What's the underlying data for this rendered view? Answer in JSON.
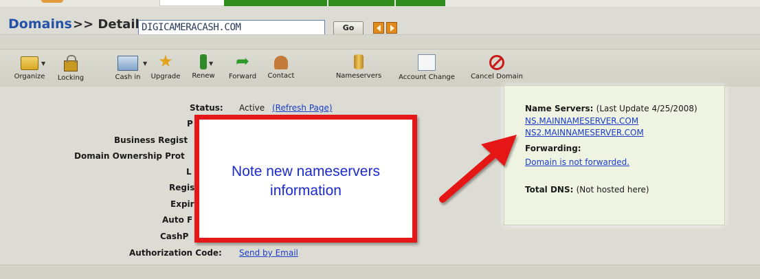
{
  "header": {
    "domains_label": "Domains",
    "details_label": ">> Details:",
    "domain_value": "DIGICAMERACASH.COM",
    "go_label": "Go"
  },
  "toolbar": {
    "items": [
      {
        "label": "Organize",
        "icon": "folder-icon"
      },
      {
        "label": "Locking",
        "icon": "lock-icon"
      },
      {
        "label": "Cash in",
        "icon": "cash-icon"
      },
      {
        "label": "Upgrade",
        "icon": "medal-icon"
      },
      {
        "label": "Renew",
        "icon": "renew-icon"
      },
      {
        "label": "Forward",
        "icon": "forward-arrow-icon"
      },
      {
        "label": "Contact",
        "icon": "contact-icon"
      },
      {
        "label": "Nameservers",
        "icon": "nameservers-icon"
      },
      {
        "label": "Account Change",
        "icon": "account-change-icon"
      },
      {
        "label": "Cancel Domain",
        "icon": "cancel-icon"
      }
    ]
  },
  "details": {
    "status_label": "Status:",
    "status_value": "Active",
    "refresh_link": "(Refresh Page)",
    "row2_label": "P",
    "business_label": "Business Regist",
    "ownership_label": "Domain Ownership Prot",
    "locked_label": "L",
    "registered_label": "Regis",
    "expires_label": "Expir",
    "auto_label": "Auto F",
    "cashparking_label": "CashP",
    "auth_label": "Authorization Code:",
    "auth_link": "Send by Email"
  },
  "callout": {
    "line1": "Note new nameservers",
    "line2": "information"
  },
  "nameserver_panel": {
    "title": "Name Servers:",
    "update": "(Last Update 4/25/2008)",
    "ns1": "NS.MAINNAMESERVER.COM",
    "ns2": "NS2.MAINNAMESERVER.COM",
    "forwarding_title": "Forwarding:",
    "forwarding_link": "Domain is not forwarded.",
    "total_dns_title": "Total DNS:",
    "total_dns_value": "(Not hosted here)"
  },
  "colors": {
    "accent_blue": "#2452a8",
    "link_blue": "#1a3cc8",
    "callout_red": "#e41818",
    "tab_green": "#2e8b1e"
  }
}
